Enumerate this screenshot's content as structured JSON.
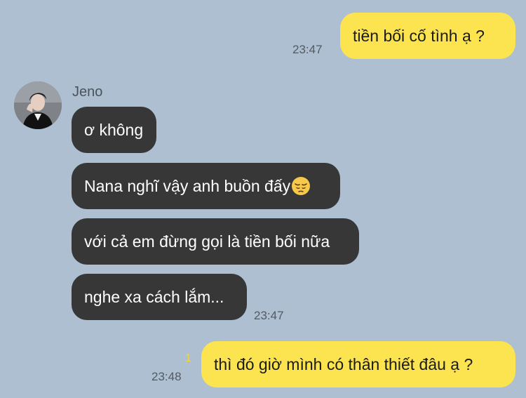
{
  "chat": {
    "messages": [
      {
        "text": "tiền bối cố tình ạ ?",
        "time": "23:47"
      },
      {
        "sender": "Jeno",
        "text": "ơ không"
      },
      {
        "text": "Nana nghĩ vậy anh buồn đấy",
        "emoji": "pensive-face"
      },
      {
        "text": "với cả em đừng gọi là tiền bối nữa"
      },
      {
        "text": "nghe xa cách lắm...",
        "time": "23:47"
      },
      {
        "text": "thì đó giờ mình có thân thiết đâu ạ ?",
        "time": "23:48",
        "unread": "1"
      }
    ]
  }
}
